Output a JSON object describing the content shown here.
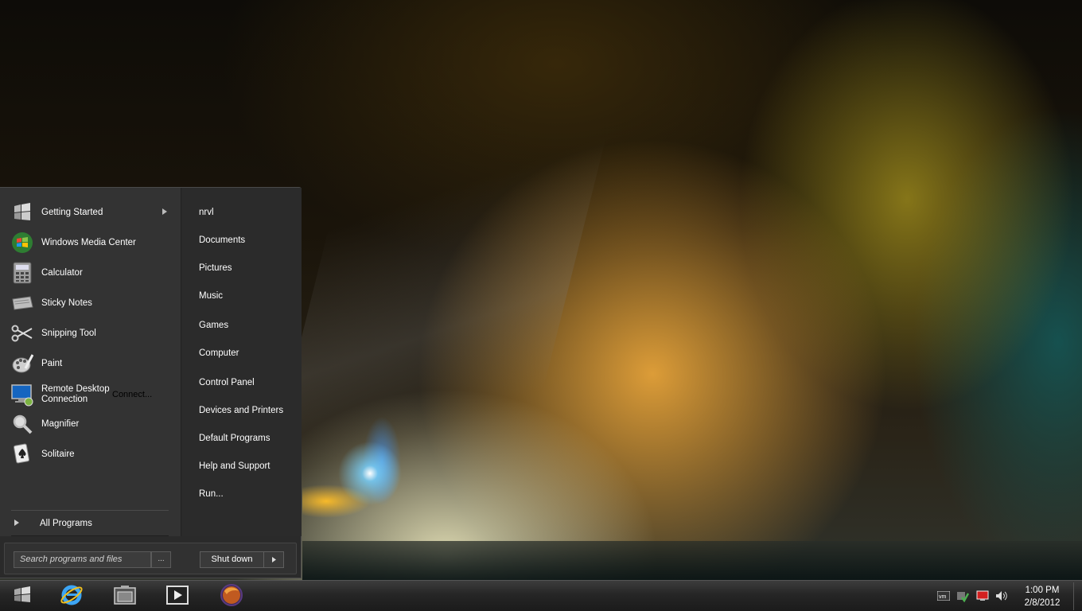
{
  "start_menu": {
    "programs": [
      {
        "label": "Getting Started",
        "icon": "windows-flag-icon",
        "has_submenu": true
      },
      {
        "label": "Windows Media Center",
        "icon": "media-center-icon",
        "has_submenu": false
      },
      {
        "label": "Calculator",
        "icon": "calculator-icon",
        "has_submenu": false
      },
      {
        "label": "Sticky Notes",
        "icon": "sticky-notes-icon",
        "has_submenu": false
      },
      {
        "label": "Snipping Tool",
        "icon": "scissors-icon",
        "has_submenu": false
      },
      {
        "label": "Paint",
        "icon": "paint-palette-icon",
        "has_submenu": false
      },
      {
        "label": "Remote Desktop Connection",
        "label_line1": "Remote Desktop",
        "label_line2": "Connection",
        "overlay_text": "Connect...",
        "icon": "remote-desktop-icon",
        "has_submenu": false
      },
      {
        "label": "Magnifier",
        "icon": "magnifier-icon",
        "has_submenu": false
      },
      {
        "label": "Solitaire",
        "icon": "playing-card-icon",
        "has_submenu": false
      }
    ],
    "all_programs_label": "All Programs",
    "places": [
      "nrvl",
      "Documents",
      "Pictures",
      "Music",
      "Games",
      "Computer",
      "Control Panel",
      "Devices and Printers",
      "Default Programs",
      "Help and Support",
      "Run..."
    ],
    "search_placeholder": "Search programs and files",
    "search_button_label": "...",
    "shutdown_label": "Shut down"
  },
  "taskbar": {
    "pinned": [
      {
        "name": "start-button",
        "icon": "windows-logo-icon"
      },
      {
        "name": "internet-explorer",
        "icon": "internet-explorer-icon"
      },
      {
        "name": "windows-explorer",
        "icon": "folder-icon"
      },
      {
        "name": "media-player",
        "icon": "media-player-icon"
      },
      {
        "name": "firefox",
        "icon": "globe-icon"
      }
    ],
    "tray_icons": [
      "vmware-icon",
      "action-center-icon",
      "network-icon",
      "volume-icon"
    ],
    "clock": {
      "time": "1:00 PM",
      "date": "2/8/2012"
    }
  },
  "colors": {
    "menu_bg": "#2a2a2a",
    "programs_bg": "#333333",
    "taskbar_bg": "#262626"
  }
}
